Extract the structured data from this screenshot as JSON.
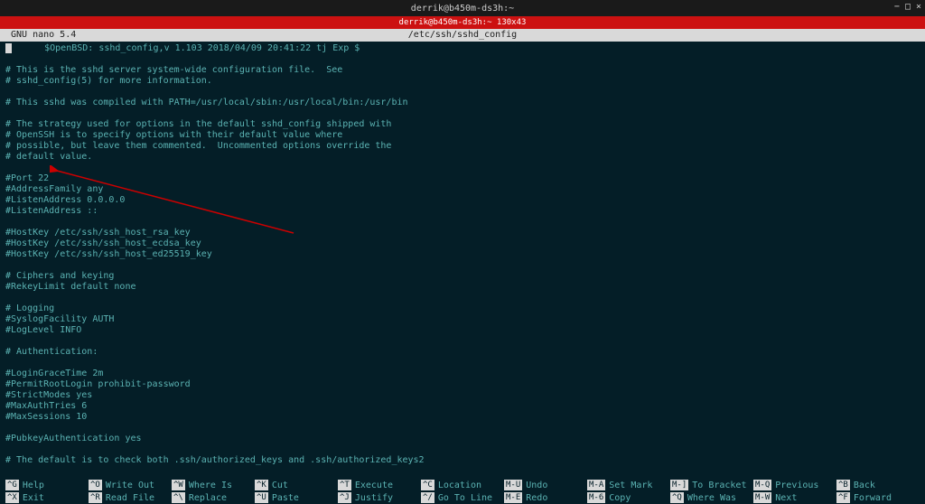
{
  "titlebar": {
    "title": "derrik@b450m-ds3h:~"
  },
  "redbar": {
    "text": "derrik@b450m-ds3h:~ 130x43"
  },
  "nano": {
    "version": "GNU nano 5.4",
    "filepath": "/etc/ssh/sshd_config"
  },
  "file_lines": [
    "      $OpenBSD: sshd_config,v 1.103 2018/04/09 20:41:22 tj Exp $",
    "",
    "# This is the sshd server system-wide configuration file.  See",
    "# sshd_config(5) for more information.",
    "",
    "# This sshd was compiled with PATH=/usr/local/sbin:/usr/local/bin:/usr/bin",
    "",
    "# The strategy used for options in the default sshd_config shipped with",
    "# OpenSSH is to specify options with their default value where",
    "# possible, but leave them commented.  Uncommented options override the",
    "# default value.",
    "",
    "#Port 22",
    "#AddressFamily any",
    "#ListenAddress 0.0.0.0",
    "#ListenAddress ::",
    "",
    "#HostKey /etc/ssh/ssh_host_rsa_key",
    "#HostKey /etc/ssh/ssh_host_ecdsa_key",
    "#HostKey /etc/ssh/ssh_host_ed25519_key",
    "",
    "# Ciphers and keying",
    "#RekeyLimit default none",
    "",
    "# Logging",
    "#SyslogFacility AUTH",
    "#LogLevel INFO",
    "",
    "# Authentication:",
    "",
    "#LoginGraceTime 2m",
    "#PermitRootLogin prohibit-password",
    "#StrictModes yes",
    "#MaxAuthTries 6",
    "#MaxSessions 10",
    "",
    "#PubkeyAuthentication yes",
    "",
    "# The default is to check both .ssh/authorized_keys and .ssh/authorized_keys2"
  ],
  "shortcuts": {
    "row1": [
      {
        "key": "^G",
        "label": "Help"
      },
      {
        "key": "^O",
        "label": "Write Out"
      },
      {
        "key": "^W",
        "label": "Where Is"
      },
      {
        "key": "^K",
        "label": "Cut"
      },
      {
        "key": "^T",
        "label": "Execute"
      },
      {
        "key": "^C",
        "label": "Location"
      },
      {
        "key": "M-U",
        "label": "Undo"
      },
      {
        "key": "M-A",
        "label": "Set Mark"
      },
      {
        "key": "M-]",
        "label": "To Bracket"
      },
      {
        "key": "M-Q",
        "label": "Previous"
      },
      {
        "key": "^B",
        "label": "Back"
      }
    ],
    "row2": [
      {
        "key": "^X",
        "label": "Exit"
      },
      {
        "key": "^R",
        "label": "Read File"
      },
      {
        "key": "^\\",
        "label": "Replace"
      },
      {
        "key": "^U",
        "label": "Paste"
      },
      {
        "key": "^J",
        "label": "Justify"
      },
      {
        "key": "^/",
        "label": "Go To Line"
      },
      {
        "key": "M-E",
        "label": "Redo"
      },
      {
        "key": "M-6",
        "label": "Copy"
      },
      {
        "key": "^Q",
        "label": "Where Was"
      },
      {
        "key": "M-W",
        "label": "Next"
      },
      {
        "key": "^F",
        "label": "Forward"
      }
    ]
  },
  "shortcut_positions": [
    6,
    98,
    190,
    282,
    374,
    466,
    558,
    650,
    742,
    834,
    926
  ]
}
